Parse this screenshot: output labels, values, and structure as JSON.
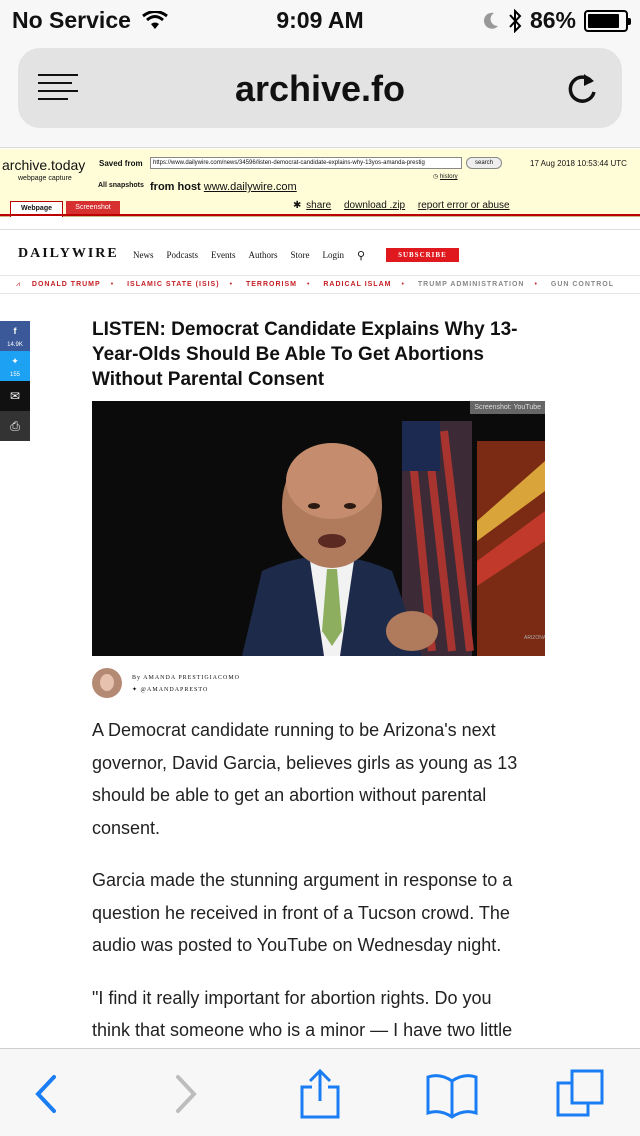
{
  "status_bar": {
    "carrier": "No Service",
    "time": "9:09 AM",
    "battery": "86%",
    "battery_level": 0.86
  },
  "browser": {
    "domain": "archive.fo"
  },
  "archive": {
    "brand": "archive.today",
    "brand_sub": "webpage capture",
    "saved_from_label": "Saved from",
    "saved_url": "https://www.dailywire.com/news/34596/listen-democrat-candidate-explains-why-13yos-amanda-prestig",
    "search_label": "search",
    "history_label": "history",
    "date": "17 Aug 2018 10:53:44 UTC",
    "all_snapshots_label": "All snapshots",
    "from_host_label": "from host",
    "host": "www.dailywire.com",
    "tab_webpage": "Webpage",
    "tab_screenshot": "Screenshot",
    "share": "share",
    "download": "download .zip",
    "report": "report error or abuse"
  },
  "site": {
    "logo": "DAILYWIRE",
    "nav": [
      "News",
      "Podcasts",
      "Events",
      "Authors",
      "Store",
      "Login"
    ],
    "search_glyph": "⚲",
    "subscribe": "SUBSCRIBE",
    "topics": [
      "DONALD TRUMP",
      "ISLAMIC STATE (ISIS)",
      "TERRORISM",
      "RADICAL ISLAM",
      "TRUMP ADMINISTRATION",
      "GUN CONTROL"
    ]
  },
  "share_bar": {
    "facebook_count": "14.9K",
    "twitter_count": "155"
  },
  "article": {
    "headline": "LISTEN: Democrat Candidate Explains Why 13-Year-Olds Should Be Able To Get Abortions Without Parental Consent",
    "photo_credit": "Screenshot: YouTube",
    "author_line": "By AMANDA PRESTIGIACOMO",
    "author_handle": "@AMANDAPRESTO",
    "paragraphs": [
      "A Democrat candidate running to be Arizona's next governor, David Garcia, believes girls as young as 13 should be able to get an abortion without parental consent.",
      "Garcia made the stunning argument in response to a question he received in front of a Tucson crowd. The audio was posted to YouTube on Wednesday night.",
      "\"I find it really important for abortion rights. Do you think that someone who is a minor — I have two little"
    ]
  },
  "colors": {
    "accent": "#e0191f",
    "ios_blue": "#1a7df3",
    "archive_bg": "#fffdd8"
  }
}
